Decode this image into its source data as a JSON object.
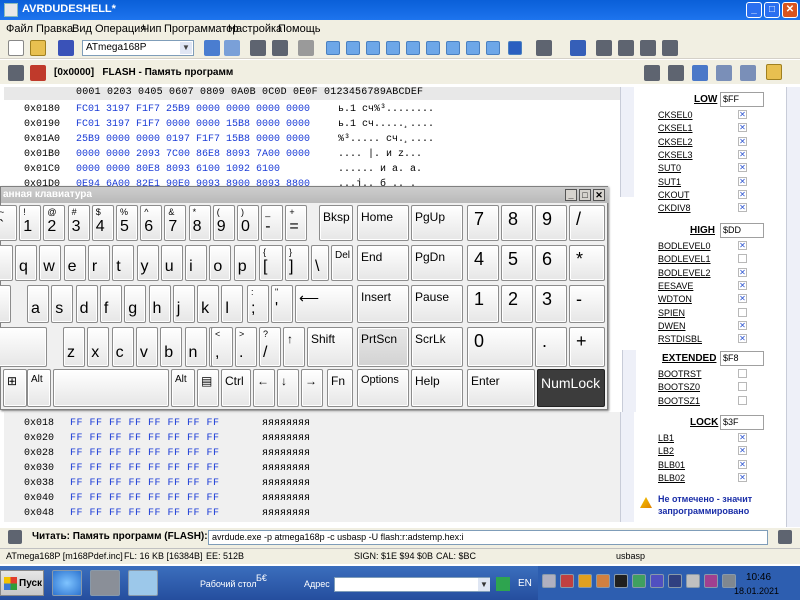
{
  "window": {
    "title": "AVRDUDESHELL*"
  },
  "menu": [
    "Файл",
    "Правка",
    "Вид",
    "Операция",
    "Чип",
    "Программатор",
    "Настройка",
    "Помощь"
  ],
  "toolbar": {
    "chip": "ATmega168P"
  },
  "header": {
    "address": "[0x0000]",
    "label": "FLASH - Память программ"
  },
  "hex": {
    "columns": "0001 0203 0405 0607 0809 0A0B 0C0D 0E0F   0123456789ABCDEF",
    "rows": [
      {
        "addr": "0x0180",
        "bytes": "FC01 3197 F1F7 25B9 0000 0000 0000 0000",
        "ascii": "ь.1 сч%³........"
      },
      {
        "addr": "0x0190",
        "bytes": "FC01 3197 F1F7 0000 0000 15B8 0000 0000",
        "ascii": "ь.1 сч.....¸...."
      },
      {
        "addr": "0x01A0",
        "bytes": "25B9 0000 0000 0197 F1F7 15B8 0000 0000",
        "ascii": "%³..... сч.¸...."
      },
      {
        "addr": "0x01B0",
        "bytes": "0000 0000 2093 7C00 86E8 8093 7A00 0000",
        "ascii": "....  |. и  z..."
      },
      {
        "addr": "0x01C0",
        "bytes": "0000 0000 80E8 8093 6100 1092 6100",
        "ascii": "...... и a. a."
      },
      {
        "addr": "0x01D0",
        "bytes": "0E94 6A00 82E1 90E0 9093 8900 8093 8800",
        "ascii": "...j.. б .. ."
      }
    ],
    "rows2": [
      {
        "addr": "0x018",
        "bytes": "FF FF FF FF FF FF FF FF",
        "ascii": "яяяяяяяя"
      },
      {
        "addr": "0x020",
        "bytes": "FF FF FF FF FF FF FF FF",
        "ascii": "яяяяяяяя"
      },
      {
        "addr": "0x028",
        "bytes": "FF FF FF FF FF FF FF FF",
        "ascii": "яяяяяяяя"
      },
      {
        "addr": "0x030",
        "bytes": "FF FF FF FF FF FF FF FF",
        "ascii": "яяяяяяяя"
      },
      {
        "addr": "0x038",
        "bytes": "FF FF FF FF FF FF FF FF",
        "ascii": "яяяяяяяя"
      },
      {
        "addr": "0x040",
        "bytes": "FF FF FF FF FF FF FF FF",
        "ascii": "яяяяяяяя"
      },
      {
        "addr": "0x048",
        "bytes": "FF FF FF FF FF FF FF FF",
        "ascii": "яяяяяяяя"
      }
    ]
  },
  "fuses": {
    "low": {
      "label": "LOW",
      "value": "$FF",
      "bits": [
        {
          "name": "CKSEL0",
          "checked": true
        },
        {
          "name": "CKSEL1",
          "checked": true
        },
        {
          "name": "CKSEL2",
          "checked": true
        },
        {
          "name": "CKSEL3",
          "checked": true
        },
        {
          "name": "SUT0",
          "checked": true
        },
        {
          "name": "SUT1",
          "checked": true
        },
        {
          "name": "CKOUT",
          "checked": true
        },
        {
          "name": "CKDIV8",
          "checked": true
        }
      ]
    },
    "high": {
      "label": "HIGH",
      "value": "$DD",
      "bits": [
        {
          "name": "BODLEVEL0",
          "checked": true
        },
        {
          "name": "BODLEVEL1",
          "checked": false
        },
        {
          "name": "BODLEVEL2",
          "checked": true
        },
        {
          "name": "EESAVE",
          "checked": true
        },
        {
          "name": "WDTON",
          "checked": true
        },
        {
          "name": "SPIEN",
          "checked": false
        },
        {
          "name": "DWEN",
          "checked": true
        },
        {
          "name": "RSTDISBL",
          "checked": true
        }
      ]
    },
    "extended": {
      "label": "EXTENDED",
      "value": "$F8",
      "bits": [
        {
          "name": "BOOTRST",
          "checked": false
        },
        {
          "name": "BOOTSZ0",
          "checked": false
        },
        {
          "name": "BOOTSZ1",
          "checked": false
        }
      ]
    },
    "lock": {
      "label": "LOCK",
      "value": "$3F",
      "bits": [
        {
          "name": "LB1",
          "checked": true
        },
        {
          "name": "LB2",
          "checked": true
        },
        {
          "name": "BLB01",
          "checked": true
        },
        {
          "name": "BLB02",
          "checked": true
        }
      ]
    }
  },
  "warning": {
    "line1": "Не отмечено - значит",
    "line2": "запрограммировано"
  },
  "command": {
    "label": "Читать: Память программ (FLASH):",
    "value": "avrdude.exe -p atmega168p -c usbasp -U flash:r:adstemp.hex:i"
  },
  "status": {
    "chip": "ATmega168P [m168Pdef.inc]",
    "flash": "FL: 16 KB [16384B]",
    "eeprom": "EE: 512B",
    "sign": "SIGN: $1E $94 $0B",
    "cal": "CAL: $BC",
    "prog": "usbasp"
  },
  "keyboard": {
    "title": "анная клавиатура",
    "rows": [
      [
        {
          "s": "~",
          "m": "`"
        },
        {
          "s": "!",
          "m": "1"
        },
        {
          "s": "@",
          "m": "2"
        },
        {
          "s": "#",
          "m": "3"
        },
        {
          "s": "$",
          "m": "4"
        },
        {
          "s": "%",
          "m": "5"
        },
        {
          "s": "^",
          "m": "6"
        },
        {
          "s": "&",
          "m": "7"
        },
        {
          "s": "*",
          "m": "8"
        },
        {
          "s": "(",
          "m": "9"
        },
        {
          "s": ")",
          "m": "0"
        },
        {
          "s": "_",
          "m": "-"
        },
        {
          "s": "+",
          "m": "="
        }
      ],
      [
        "q",
        "w",
        "e",
        "r",
        "t",
        "y",
        "u",
        "i",
        "o",
        "p"
      ],
      [
        "a",
        "s",
        "d",
        "f",
        "g",
        "h",
        "j",
        "k",
        "l"
      ],
      [
        "z",
        "x",
        "c",
        "v",
        "b",
        "n",
        "m"
      ]
    ],
    "extra": {
      "bksp": "Bksp",
      "del": "Del",
      "shift": "Shift",
      "home": "Home",
      "pgup": "PgUp",
      "end": "End",
      "pgdn": "PgDn",
      "insert": "Insert",
      "pause": "Pause",
      "prtscn": "PrtScn",
      "scrlk": "ScrLk",
      "options": "Options",
      "help": "Help",
      "enter": "Enter",
      "numlock": "NumLock",
      "alt": "Alt",
      "ctrl": "Ctrl",
      "fn": "Fn",
      "br_open_s": "{",
      "br_open": "[",
      "br_close_s": "}",
      "br_close": "]",
      "bs": "\\",
      "semi": ";",
      "semi_s": ":",
      "quote": "'",
      "quote_s": "\"",
      "comma": ",",
      "comma_s": "<",
      "dot": ".",
      "dot_s": ">",
      "slash": "/",
      "slash_s": "?",
      "num": [
        "7",
        "8",
        "9",
        "/",
        "4",
        "5",
        "6",
        "*",
        "1",
        "2",
        "3",
        "-",
        "0",
        ".",
        "+"
      ]
    }
  },
  "taskbar": {
    "start": "Пуск",
    "desktop": "Рабочий стол",
    "address": "Адрес",
    "lang": "EN",
    "time": "10:46",
    "date": "18.01.2021"
  }
}
